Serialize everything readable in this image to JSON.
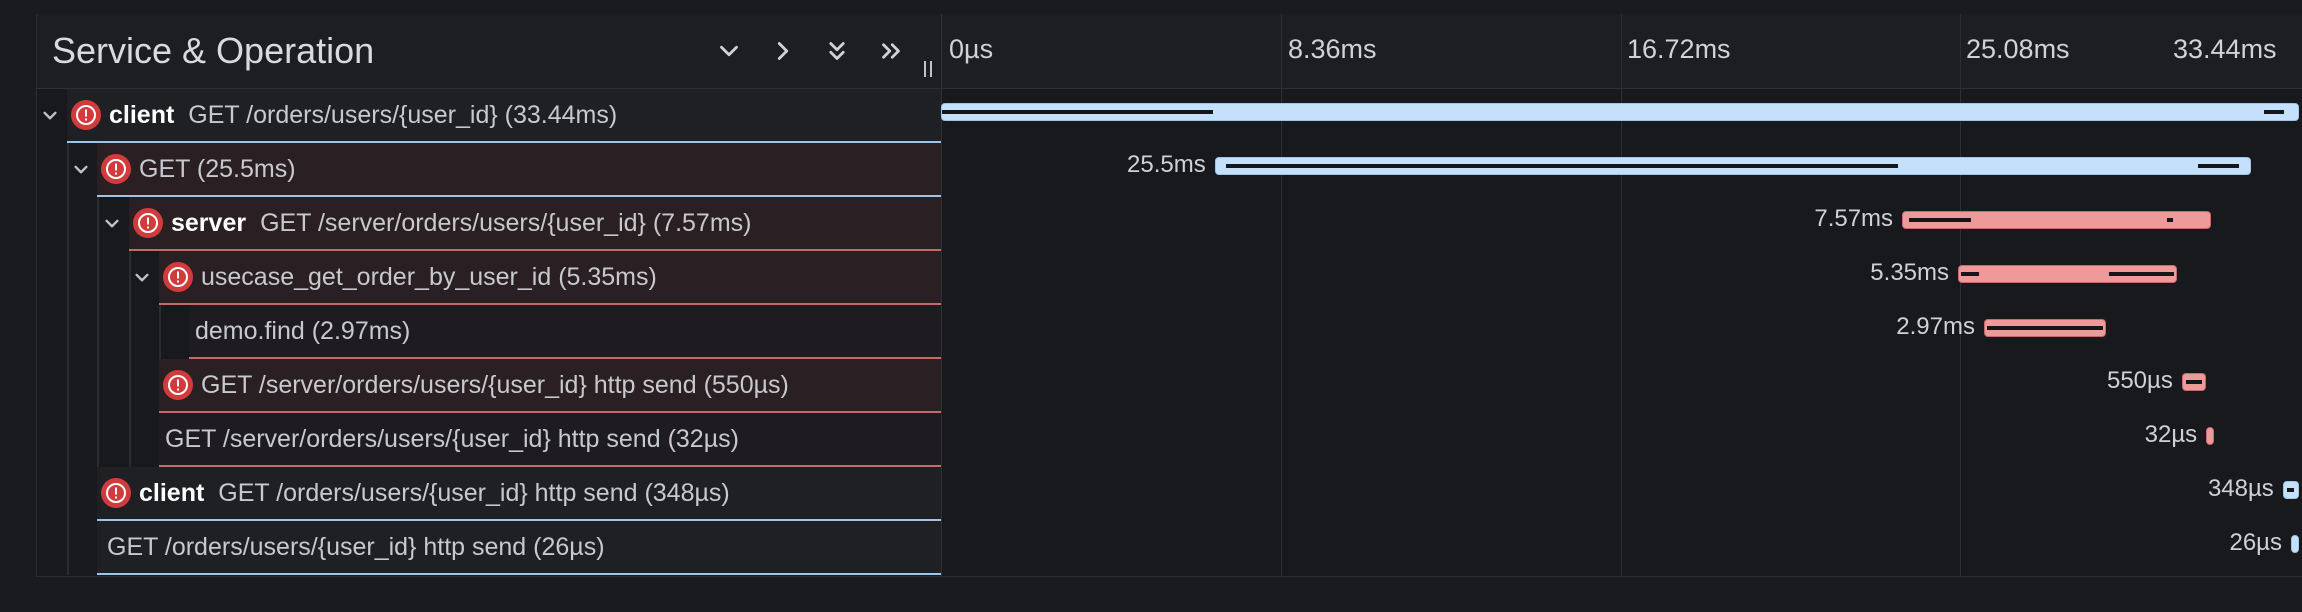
{
  "header": {
    "title": "Service & Operation",
    "ticks": [
      "0µs",
      "8.36ms",
      "16.72ms",
      "25.08ms",
      "33.44ms"
    ]
  },
  "colors": {
    "client": "#c4e0fa",
    "server": "#ef9a9a",
    "error": "#d13b3b",
    "client_border": "#9fc4e6",
    "server_border": "#c26b6b"
  },
  "trace": {
    "total_ms": 33.44,
    "spans": [
      {
        "service": "client",
        "operation": "GET /orders/users/{user_id} (33.44ms)",
        "duration_label": "",
        "start_ms": 0,
        "duration_ms": 33.44,
        "error": true,
        "expandable": true,
        "kind": "client"
      },
      {
        "service": "",
        "operation": "GET (25.5ms)",
        "duration_label": "25.5ms",
        "start_ms": 6.75,
        "duration_ms": 25.5,
        "error": true,
        "expandable": true,
        "kind": "client"
      },
      {
        "service": "server",
        "operation": "GET /server/orders/users/{user_id} (7.57ms)",
        "duration_label": "7.57ms",
        "start_ms": 23.7,
        "duration_ms": 7.57,
        "error": true,
        "expandable": true,
        "kind": "server"
      },
      {
        "service": "",
        "operation": "usecase_get_order_by_user_id (5.35ms)",
        "duration_label": "5.35ms",
        "start_ms": 25.08,
        "duration_ms": 5.35,
        "error": true,
        "expandable": true,
        "kind": "server"
      },
      {
        "service": "",
        "operation": "demo.find (2.97ms)",
        "duration_label": "2.97ms",
        "start_ms": 25.72,
        "duration_ms": 2.97,
        "error": false,
        "expandable": false,
        "kind": "server"
      },
      {
        "service": "",
        "operation": "GET /server/orders/users/{user_id} http send (550µs)",
        "duration_label": "550µs",
        "start_ms": 30.6,
        "duration_ms": 0.55,
        "error": true,
        "expandable": false,
        "kind": "server"
      },
      {
        "service": "",
        "operation": "GET /server/orders/users/{user_id} http send (32µs)",
        "duration_label": "32µs",
        "start_ms": 31.2,
        "duration_ms": 0.032,
        "error": false,
        "expandable": false,
        "kind": "server"
      },
      {
        "service": "client",
        "operation": "GET /orders/users/{user_id} http send (348µs)",
        "duration_label": "348µs",
        "start_ms": 33.09,
        "duration_ms": 0.348,
        "error": true,
        "expandable": false,
        "kind": "client"
      },
      {
        "service": "",
        "operation": "GET /orders/users/{user_id} http send (26µs)",
        "duration_label": "26µs",
        "start_ms": 33.41,
        "duration_ms": 0.026,
        "error": false,
        "expandable": false,
        "kind": "client"
      }
    ]
  }
}
